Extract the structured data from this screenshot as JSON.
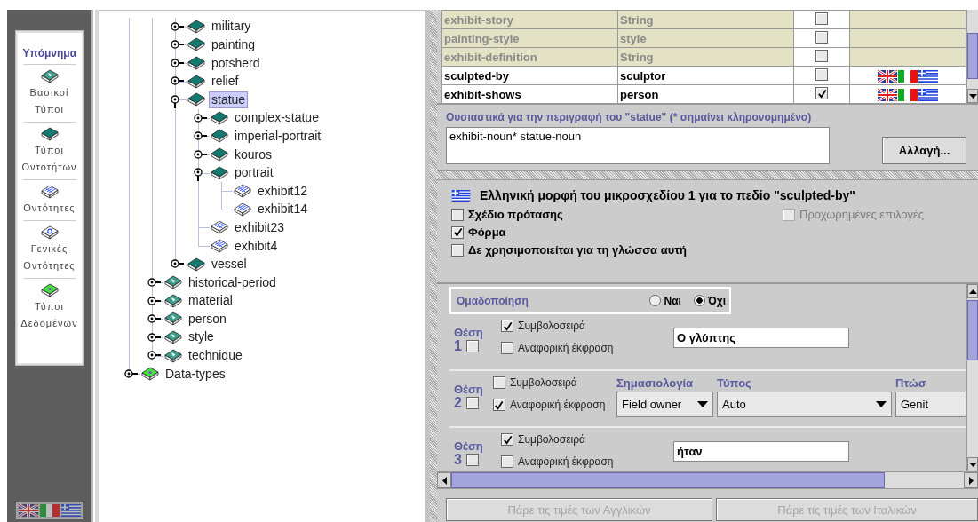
{
  "legend": {
    "title": "Υπόμνημα",
    "items": [
      {
        "kind": "basic",
        "label": "Βασικοί Τύποι"
      },
      {
        "kind": "type",
        "label": "Τύποι Οντοτήτων"
      },
      {
        "kind": "entity",
        "label": "Οντότητες"
      },
      {
        "kind": "generic",
        "label": "Γενικές Οντότητες"
      },
      {
        "kind": "datatype",
        "label": "Τύποι Δεδομένων"
      }
    ],
    "flags": [
      {
        "kind": "uk"
      },
      {
        "kind": "it"
      },
      {
        "kind": "gr"
      }
    ]
  },
  "tree": {
    "items": [
      {
        "children": [
          {
            "children": [
              {
                "label": "military",
                "kind": "type",
                "expanded": false,
                "selected": false
              },
              {
                "label": "painting",
                "kind": "type",
                "expanded": false,
                "selected": false
              },
              {
                "label": "potsherd",
                "kind": "type",
                "expanded": false,
                "selected": false
              },
              {
                "label": "relief",
                "kind": "type",
                "expanded": false,
                "selected": false
              },
              {
                "label": "statue",
                "kind": "type",
                "expanded": true,
                "selected": true,
                "children": [
                  {
                    "label": "complex-statue",
                    "kind": "type",
                    "expanded": false,
                    "selected": false
                  },
                  {
                    "label": "imperial-portrait",
                    "kind": "type",
                    "expanded": false,
                    "selected": false
                  },
                  {
                    "label": "kouros",
                    "kind": "type",
                    "expanded": false,
                    "selected": false
                  },
                  {
                    "label": "portrait",
                    "kind": "type",
                    "expanded": true,
                    "selected": false,
                    "children": [
                      {
                        "label": "exhibit12",
                        "kind": "entity",
                        "selected": false
                      },
                      {
                        "label": "exhibit14",
                        "kind": "entity",
                        "selected": false
                      }
                    ]
                  },
                  {
                    "label": "exhibit23",
                    "kind": "entity",
                    "selected": false
                  },
                  {
                    "label": "exhibit4",
                    "kind": "entity",
                    "selected": false
                  }
                ]
              },
              {
                "label": "vessel",
                "kind": "type",
                "expanded": false,
                "selected": false
              }
            ]
          },
          {
            "label": "historical-period",
            "kind": "basic",
            "expanded": false,
            "selected": false
          },
          {
            "label": "material",
            "kind": "basic",
            "expanded": false,
            "selected": false
          },
          {
            "label": "person",
            "kind": "basic",
            "expanded": false,
            "selected": false
          },
          {
            "label": "style",
            "kind": "basic",
            "expanded": false,
            "selected": false
          },
          {
            "label": "technique",
            "kind": "basic",
            "expanded": false,
            "selected": false
          }
        ]
      },
      {
        "label": "Data-types",
        "kind": "datatype",
        "expanded": false,
        "selected": false
      }
    ]
  },
  "table": {
    "rows": [
      {
        "name": "exhibit-story",
        "type": "String",
        "inherited": true,
        "checked": false,
        "flags": []
      },
      {
        "name": "painting-style",
        "type": "style",
        "inherited": true,
        "checked": false,
        "flags": []
      },
      {
        "name": "exhibit-definition",
        "type": "String",
        "inherited": true,
        "checked": false,
        "flags": []
      },
      {
        "name": "sculpted-by",
        "type": "sculptor",
        "inherited": false,
        "checked": false,
        "flags": [
          {
            "kind": "uk"
          },
          {
            "kind": "it"
          },
          {
            "kind": "gr"
          }
        ]
      },
      {
        "name": "exhibit-shows",
        "type": "person",
        "inherited": false,
        "checked": true,
        "flags": [
          {
            "kind": "uk"
          },
          {
            "kind": "it"
          },
          {
            "kind": "gr"
          }
        ]
      }
    ]
  },
  "essentials": {
    "label": "Ουσιαστικά για την περιγραφή του  \"statue\" (* σημαίνει κληρονομημένο)",
    "value": "exhibit-noun*  statue-noun",
    "button": "Αλλαγή..."
  },
  "microplan": {
    "flag": {
      "kind": "gr"
    },
    "title": "Ελληνική μορφή του  μικροσχεδίου 1 για το πεδίο \"sculpted-by\"",
    "options": [
      {
        "label": "Σχέδιο πρότασης",
        "checked": false,
        "disabled": false
      },
      {
        "label": "Φόρμα",
        "checked": true,
        "disabled": false
      },
      {
        "label": "Δε χρησιμοποιείται για τη γλώσσα αυτή",
        "checked": false,
        "disabled": false
      }
    ],
    "advanced": {
      "label": "Προχωρημένες επιλογές",
      "checked": false,
      "disabled": true
    }
  },
  "grouping": {
    "label": "Ομαδοποίηση",
    "options": [
      {
        "label": "Ναι",
        "selected": false
      },
      {
        "label": "Όχι",
        "selected": true
      }
    ]
  },
  "slots": [
    {
      "label": "Θέση",
      "number": "1",
      "checked": false,
      "string": {
        "label": "Συμβολοσειρά",
        "checked": true
      },
      "reference": {
        "label": "Αναφορική έκφραση",
        "checked": false
      },
      "kind": "text",
      "value": "Ο γλύπτης"
    },
    {
      "label": "Θέση",
      "number": "2",
      "checked": false,
      "string": {
        "label": "Συμβολοσειρά",
        "checked": false
      },
      "reference": {
        "label": "Αναφορική έκφραση",
        "checked": true
      },
      "kind": "combos",
      "combos": [
        {
          "header": "Σημασιολογία",
          "value": "Field owner"
        },
        {
          "header": "Τύπος",
          "value": "Auto"
        },
        {
          "header": "Πτώσ",
          "value": "Genit"
        }
      ]
    },
    {
      "label": "Θέση",
      "number": "3",
      "checked": false,
      "string": {
        "label": "Συμβολοσειρά",
        "checked": true
      },
      "reference": {
        "label": "Αναφορική έκφραση",
        "checked": false
      },
      "kind": "text",
      "value": "ήταν"
    }
  ],
  "footer_buttons": [
    {
      "label": "Πάρε τις τιμές των Αγγλικών",
      "disabled": true
    },
    {
      "label": "Πάρε τις τιμές των Ιταλικών",
      "disabled": true
    }
  ]
}
